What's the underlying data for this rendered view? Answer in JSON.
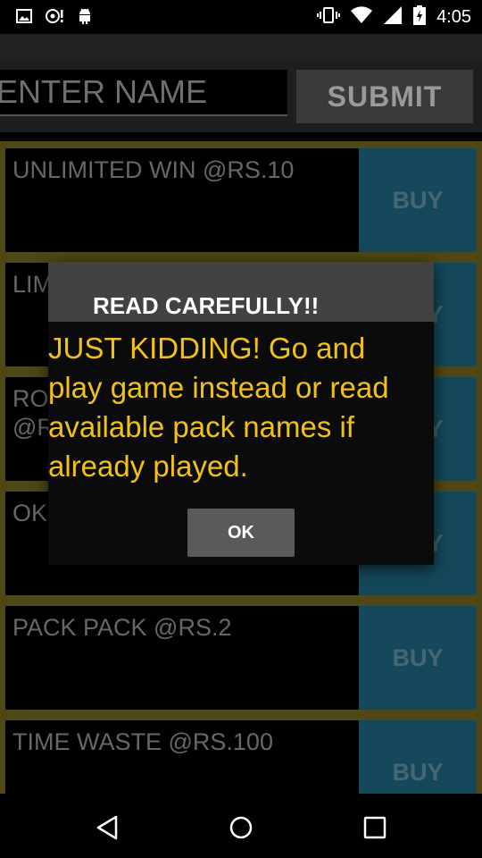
{
  "status_bar": {
    "time": "4:05",
    "left_icons": [
      "image-icon",
      "notification-icon",
      "android-icon"
    ],
    "right_icons": [
      "vibrate-icon",
      "wifi-icon",
      "cell-signal-icon",
      "battery-icon"
    ]
  },
  "form": {
    "name_placeholder": "ENTER NAME",
    "submit_label": "SUBMIT"
  },
  "packs": [
    {
      "label": "UNLIMITED WIN @RS.10",
      "buy_label": "BUY"
    },
    {
      "label": "LIM",
      "buy_label": "BUY"
    },
    {
      "label": "RO\n@R",
      "buy_label": "BUY"
    },
    {
      "label": "OK",
      "buy_label": "BUY"
    },
    {
      "label": "PACK PACK @RS.2",
      "buy_label": "BUY"
    },
    {
      "label": "TIME WASTE @RS.100",
      "buy_label": "BUY"
    }
  ],
  "dialog": {
    "title": "READ CAREFULLY!!",
    "message": "JUST KIDDING! Go and play game instead or read available pack names if already played.",
    "ok_label": "OK"
  },
  "nav": {
    "icons": [
      "back-icon",
      "home-icon",
      "recents-icon"
    ]
  },
  "colors": {
    "accent_gold": "#f2c118",
    "buy_blue": "#1f6f8b",
    "border_olive": "#7a6f22"
  }
}
